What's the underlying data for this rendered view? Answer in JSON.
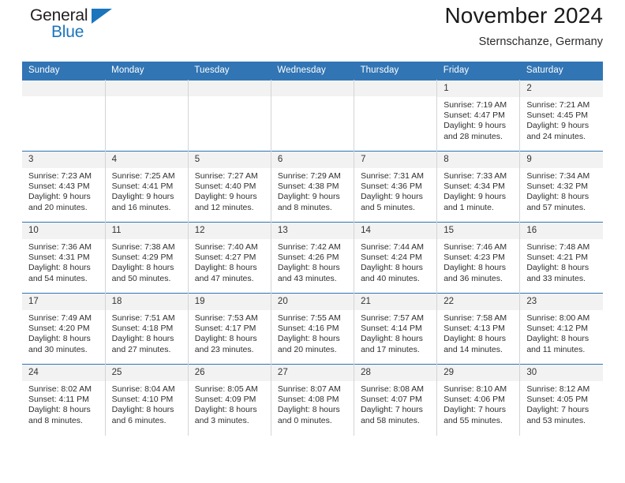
{
  "brand": {
    "name_top": "General",
    "name_bottom": "Blue",
    "accent_color": "#1b75bc"
  },
  "header": {
    "title": "November 2024",
    "subtitle": "Sternschanze, Germany"
  },
  "calendar": {
    "header_color": "#3175b4",
    "weekday_headers": [
      "Sunday",
      "Monday",
      "Tuesday",
      "Wednesday",
      "Thursday",
      "Friday",
      "Saturday"
    ],
    "labels": {
      "sunrise_prefix": "Sunrise: ",
      "sunset_prefix": "Sunset: ",
      "daylight_prefix": "Daylight: "
    },
    "weeks": [
      [
        {
          "day": "",
          "empty": true
        },
        {
          "day": "",
          "empty": true
        },
        {
          "day": "",
          "empty": true
        },
        {
          "day": "",
          "empty": true
        },
        {
          "day": "",
          "empty": true
        },
        {
          "day": "1",
          "sunrise": "Sunrise: 7:19 AM",
          "sunset": "Sunset: 4:47 PM",
          "daylight": "Daylight: 9 hours and 28 minutes."
        },
        {
          "day": "2",
          "sunrise": "Sunrise: 7:21 AM",
          "sunset": "Sunset: 4:45 PM",
          "daylight": "Daylight: 9 hours and 24 minutes."
        }
      ],
      [
        {
          "day": "3",
          "sunrise": "Sunrise: 7:23 AM",
          "sunset": "Sunset: 4:43 PM",
          "daylight": "Daylight: 9 hours and 20 minutes."
        },
        {
          "day": "4",
          "sunrise": "Sunrise: 7:25 AM",
          "sunset": "Sunset: 4:41 PM",
          "daylight": "Daylight: 9 hours and 16 minutes."
        },
        {
          "day": "5",
          "sunrise": "Sunrise: 7:27 AM",
          "sunset": "Sunset: 4:40 PM",
          "daylight": "Daylight: 9 hours and 12 minutes."
        },
        {
          "day": "6",
          "sunrise": "Sunrise: 7:29 AM",
          "sunset": "Sunset: 4:38 PM",
          "daylight": "Daylight: 9 hours and 8 minutes."
        },
        {
          "day": "7",
          "sunrise": "Sunrise: 7:31 AM",
          "sunset": "Sunset: 4:36 PM",
          "daylight": "Daylight: 9 hours and 5 minutes."
        },
        {
          "day": "8",
          "sunrise": "Sunrise: 7:33 AM",
          "sunset": "Sunset: 4:34 PM",
          "daylight": "Daylight: 9 hours and 1 minute."
        },
        {
          "day": "9",
          "sunrise": "Sunrise: 7:34 AM",
          "sunset": "Sunset: 4:32 PM",
          "daylight": "Daylight: 8 hours and 57 minutes."
        }
      ],
      [
        {
          "day": "10",
          "sunrise": "Sunrise: 7:36 AM",
          "sunset": "Sunset: 4:31 PM",
          "daylight": "Daylight: 8 hours and 54 minutes."
        },
        {
          "day": "11",
          "sunrise": "Sunrise: 7:38 AM",
          "sunset": "Sunset: 4:29 PM",
          "daylight": "Daylight: 8 hours and 50 minutes."
        },
        {
          "day": "12",
          "sunrise": "Sunrise: 7:40 AM",
          "sunset": "Sunset: 4:27 PM",
          "daylight": "Daylight: 8 hours and 47 minutes."
        },
        {
          "day": "13",
          "sunrise": "Sunrise: 7:42 AM",
          "sunset": "Sunset: 4:26 PM",
          "daylight": "Daylight: 8 hours and 43 minutes."
        },
        {
          "day": "14",
          "sunrise": "Sunrise: 7:44 AM",
          "sunset": "Sunset: 4:24 PM",
          "daylight": "Daylight: 8 hours and 40 minutes."
        },
        {
          "day": "15",
          "sunrise": "Sunrise: 7:46 AM",
          "sunset": "Sunset: 4:23 PM",
          "daylight": "Daylight: 8 hours and 36 minutes."
        },
        {
          "day": "16",
          "sunrise": "Sunrise: 7:48 AM",
          "sunset": "Sunset: 4:21 PM",
          "daylight": "Daylight: 8 hours and 33 minutes."
        }
      ],
      [
        {
          "day": "17",
          "sunrise": "Sunrise: 7:49 AM",
          "sunset": "Sunset: 4:20 PM",
          "daylight": "Daylight: 8 hours and 30 minutes."
        },
        {
          "day": "18",
          "sunrise": "Sunrise: 7:51 AM",
          "sunset": "Sunset: 4:18 PM",
          "daylight": "Daylight: 8 hours and 27 minutes."
        },
        {
          "day": "19",
          "sunrise": "Sunrise: 7:53 AM",
          "sunset": "Sunset: 4:17 PM",
          "daylight": "Daylight: 8 hours and 23 minutes."
        },
        {
          "day": "20",
          "sunrise": "Sunrise: 7:55 AM",
          "sunset": "Sunset: 4:16 PM",
          "daylight": "Daylight: 8 hours and 20 minutes."
        },
        {
          "day": "21",
          "sunrise": "Sunrise: 7:57 AM",
          "sunset": "Sunset: 4:14 PM",
          "daylight": "Daylight: 8 hours and 17 minutes."
        },
        {
          "day": "22",
          "sunrise": "Sunrise: 7:58 AM",
          "sunset": "Sunset: 4:13 PM",
          "daylight": "Daylight: 8 hours and 14 minutes."
        },
        {
          "day": "23",
          "sunrise": "Sunrise: 8:00 AM",
          "sunset": "Sunset: 4:12 PM",
          "daylight": "Daylight: 8 hours and 11 minutes."
        }
      ],
      [
        {
          "day": "24",
          "sunrise": "Sunrise: 8:02 AM",
          "sunset": "Sunset: 4:11 PM",
          "daylight": "Daylight: 8 hours and 8 minutes."
        },
        {
          "day": "25",
          "sunrise": "Sunrise: 8:04 AM",
          "sunset": "Sunset: 4:10 PM",
          "daylight": "Daylight: 8 hours and 6 minutes."
        },
        {
          "day": "26",
          "sunrise": "Sunrise: 8:05 AM",
          "sunset": "Sunset: 4:09 PM",
          "daylight": "Daylight: 8 hours and 3 minutes."
        },
        {
          "day": "27",
          "sunrise": "Sunrise: 8:07 AM",
          "sunset": "Sunset: 4:08 PM",
          "daylight": "Daylight: 8 hours and 0 minutes."
        },
        {
          "day": "28",
          "sunrise": "Sunrise: 8:08 AM",
          "sunset": "Sunset: 4:07 PM",
          "daylight": "Daylight: 7 hours and 58 minutes."
        },
        {
          "day": "29",
          "sunrise": "Sunrise: 8:10 AM",
          "sunset": "Sunset: 4:06 PM",
          "daylight": "Daylight: 7 hours and 55 minutes."
        },
        {
          "day": "30",
          "sunrise": "Sunrise: 8:12 AM",
          "sunset": "Sunset: 4:05 PM",
          "daylight": "Daylight: 7 hours and 53 minutes."
        }
      ]
    ]
  }
}
